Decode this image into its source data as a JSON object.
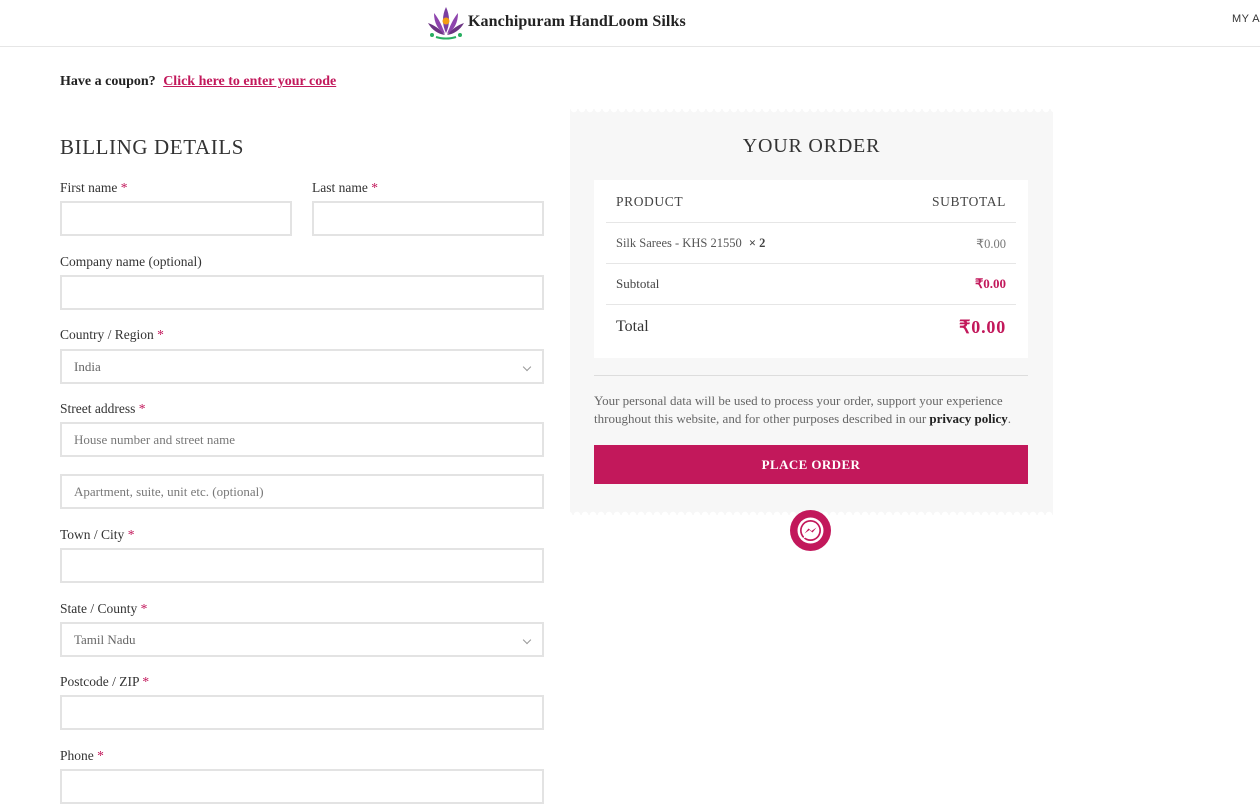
{
  "header": {
    "brand": "Kanchipuram HandLoom Silks",
    "my_account": "MY ACCOUNT"
  },
  "coupon": {
    "prompt": "Have a coupon?",
    "link": "Click here to enter your code"
  },
  "billing": {
    "title": "BILLING DETAILS",
    "required_marker": "*",
    "fields": {
      "first_name": {
        "label": "First name",
        "value": ""
      },
      "last_name": {
        "label": "Last name",
        "value": ""
      },
      "company": {
        "label": "Company name (optional)",
        "value": ""
      },
      "country": {
        "label": "Country / Region",
        "value": "India"
      },
      "street": {
        "label": "Street address",
        "placeholder1": "House number and street name",
        "placeholder2": "Apartment, suite, unit etc. (optional)"
      },
      "city": {
        "label": "Town / City",
        "value": ""
      },
      "state": {
        "label": "State / County",
        "value": "Tamil Nadu"
      },
      "postcode": {
        "label": "Postcode / ZIP",
        "value": ""
      },
      "phone": {
        "label": "Phone",
        "value": ""
      }
    }
  },
  "order": {
    "title": "YOUR ORDER",
    "col_product": "PRODUCT",
    "col_subtotal": "SUBTOTAL",
    "item_name": "Silk Sarees - KHS 21550",
    "item_qty": "× 2",
    "item_price": "₹0.00",
    "subtotal_label": "Subtotal",
    "subtotal_value": "₹0.00",
    "total_label": "Total",
    "total_value": "₹0.00",
    "privacy_text": "Your personal data will be used to process your order, support your experience throughout this website, and for other purposes described in our",
    "privacy_link": "privacy policy",
    "place_order": "PLACE ORDER"
  },
  "colors": {
    "accent": "#c2185b",
    "panel_bg": "#f7f7f7"
  },
  "icons": [
    "lotus-logo-icon",
    "chevron-down-icon",
    "messenger-icon"
  ]
}
